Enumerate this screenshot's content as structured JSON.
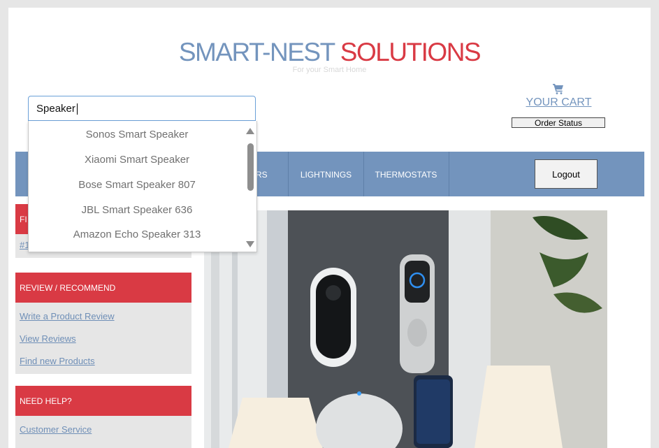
{
  "brand": {
    "title_a": "SMART-NEST",
    "title_b": "SOLUTIONS",
    "tagline": "For your Smart Home"
  },
  "search": {
    "value": "Speaker",
    "suggestions": [
      "Sonos Smart Speaker",
      "Xiaomi Smart Speaker",
      "Bose Smart Speaker 807",
      "JBL Smart Speaker 636",
      "Amazon Echo Speaker 313"
    ]
  },
  "header": {
    "cart_label": "YOUR CART",
    "order_status": "Order Status"
  },
  "nav": {
    "items": [
      "KERS",
      "LIGHTNINGS",
      "THERMOSTATS"
    ],
    "logout": "Logout"
  },
  "sidebar": {
    "section1": {
      "heading": "FI",
      "links": [
        "#1"
      ]
    },
    "section2": {
      "heading": "REVIEW / RECOMMEND",
      "links": [
        "Write a Product Review",
        "View Reviews",
        "Find new Products"
      ]
    },
    "section3": {
      "heading": "NEED HELP?",
      "links": [
        "Customer Service"
      ]
    }
  },
  "colors": {
    "brand_blue": "#7394bd",
    "brand_red": "#d93a44",
    "nav_bg": "#7394bd",
    "sidebar_bg": "#e6e6e6"
  },
  "icons": {
    "cart": "cart-icon",
    "scroll_up": "scroll-up-arrow",
    "scroll_down": "scroll-down-arrow"
  }
}
